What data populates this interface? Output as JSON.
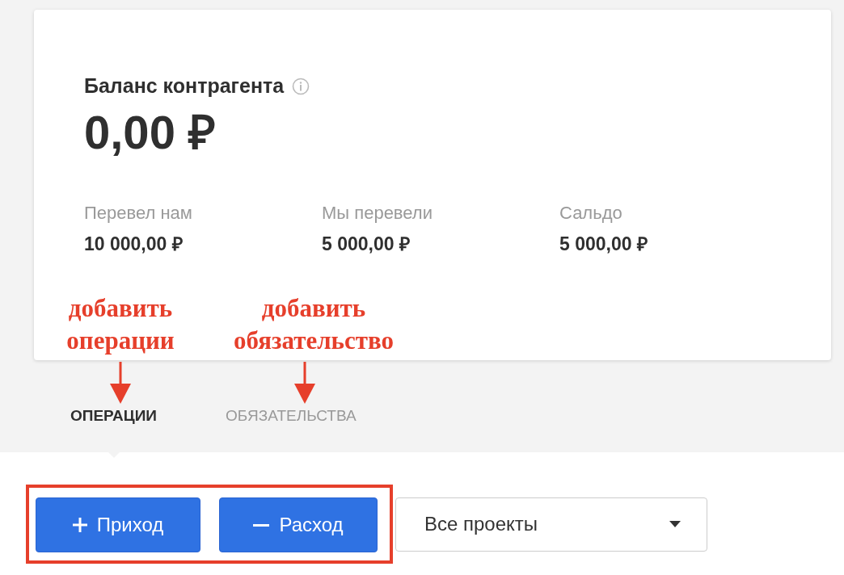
{
  "card": {
    "title": "Баланс контрагента",
    "balance": "0,00 ₽",
    "stats": [
      {
        "label": "Перевел нам",
        "value": "10 000,00 ₽"
      },
      {
        "label": "Мы перевели",
        "value": "5 000,00 ₽"
      },
      {
        "label": "Сальдо",
        "value": "5 000,00 ₽"
      }
    ]
  },
  "tabs": [
    {
      "label": "ОПЕРАЦИИ",
      "selected": true
    },
    {
      "label": "ОБЯЗАТЕЛЬСТВА",
      "selected": false
    }
  ],
  "buttons": [
    {
      "kind": "plus",
      "label": "Приход"
    },
    {
      "kind": "minus",
      "label": "Расход"
    }
  ],
  "project_select": {
    "value": "Все проекты"
  },
  "annotations": [
    {
      "text": "добавить операции"
    },
    {
      "text": "добавить обязательство"
    }
  ]
}
